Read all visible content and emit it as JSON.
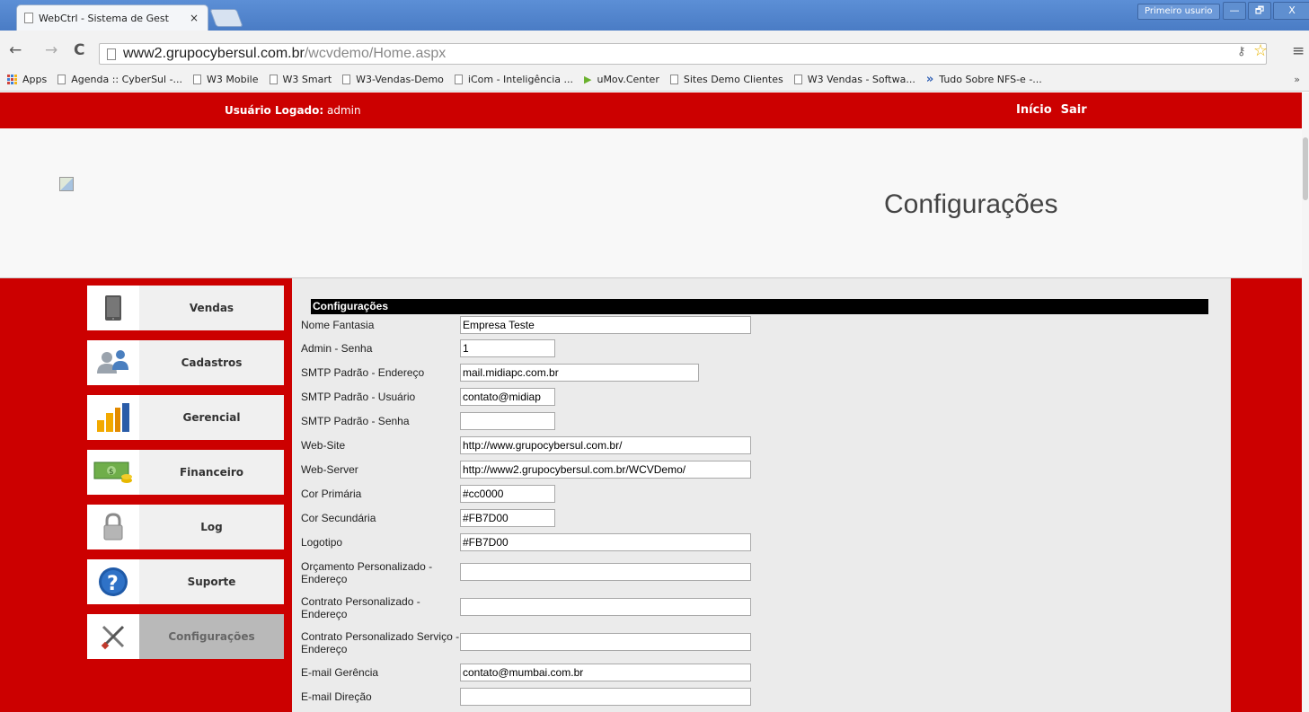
{
  "browser": {
    "tab_title": "WebCtrl - Sistema de Gest",
    "tab_close": "×",
    "profile_label": "Primeiro usurio",
    "window_buttons": {
      "minimize": "—",
      "restore": "🗗",
      "close": "X"
    },
    "url_host": "www2.grupocybersul.com.br",
    "url_path": "/wcvdemo/Home.aspx",
    "nav": {
      "back": "←",
      "forward": "→",
      "reload": "C"
    },
    "key_icon": "⚷",
    "star_icon": "☆",
    "menu_icon": "≡",
    "bookmarks": [
      {
        "label": "Apps",
        "icon": "apps-icon"
      },
      {
        "label": "Agenda :: CyberSul -...",
        "icon": "page-icon"
      },
      {
        "label": "W3 Mobile",
        "icon": "page-icon"
      },
      {
        "label": "W3 Smart",
        "icon": "page-icon"
      },
      {
        "label": "W3-Vendas-Demo",
        "icon": "page-icon"
      },
      {
        "label": "iCom - Inteligência ...",
        "icon": "page-icon"
      },
      {
        "label": "uMov.Center",
        "icon": "arrow-green-icon"
      },
      {
        "label": "Sites Demo Clientes",
        "icon": "page-icon"
      },
      {
        "label": "W3 Vendas - Softwa...",
        "icon": "page-icon"
      },
      {
        "label": "Tudo Sobre NFS-e -...",
        "icon": "arrow-blue-icon"
      }
    ],
    "bookmarks_more": "»"
  },
  "topbar": {
    "user_label": "Usuário Logado:",
    "user_name": " admin",
    "links": {
      "home": "Início",
      "logout": "Sair"
    }
  },
  "header": {
    "title": "Configurações"
  },
  "sidebar": {
    "items": [
      {
        "label": "Vendas",
        "icon": "tablet-icon"
      },
      {
        "label": "Cadastros",
        "icon": "users-icon"
      },
      {
        "label": "Gerencial",
        "icon": "bar-chart-icon"
      },
      {
        "label": "Financeiro",
        "icon": "money-icon"
      },
      {
        "label": "Log",
        "icon": "lock-icon"
      },
      {
        "label": "Suporte",
        "icon": "help-icon"
      },
      {
        "label": "Configurações",
        "icon": "tools-icon",
        "active": true
      }
    ]
  },
  "form": {
    "section_title": "Configurações",
    "fields": [
      {
        "label": "Nome Fantasia",
        "value": "Empresa Teste"
      },
      {
        "label": "Admin - Senha",
        "value": "1"
      },
      {
        "label": "SMTP Padrão - Endereço",
        "value": "mail.midiapc.com.br"
      },
      {
        "label": "SMTP Padrão - Usuário",
        "value": "contato@midiap"
      },
      {
        "label": "SMTP Padrão - Senha",
        "value": ""
      },
      {
        "label": "Web-Site",
        "value": "http://www.grupocybersul.com.br/"
      },
      {
        "label": "Web-Server",
        "value": "http://www2.grupocybersul.com.br/WCVDemo/"
      },
      {
        "label": "Cor Primária",
        "value": "#cc0000"
      },
      {
        "label": "Cor Secundária",
        "value": "#FB7D00"
      },
      {
        "label": "Logotipo",
        "value": "#FB7D00"
      },
      {
        "label": "Orçamento Personalizado - Endereço",
        "value": ""
      },
      {
        "label": "Contrato Personalizado - Endereço",
        "value": ""
      },
      {
        "label": "Contrato Personalizado Serviço - Endereço",
        "value": ""
      },
      {
        "label": "E-mail Gerência",
        "value": "contato@mumbai.com.br"
      },
      {
        "label": "E-mail Direção",
        "value": ""
      }
    ]
  },
  "colors": {
    "primary": "#cc0000",
    "secondary": "#FB7D00",
    "chrome": "#5c8fd6"
  }
}
